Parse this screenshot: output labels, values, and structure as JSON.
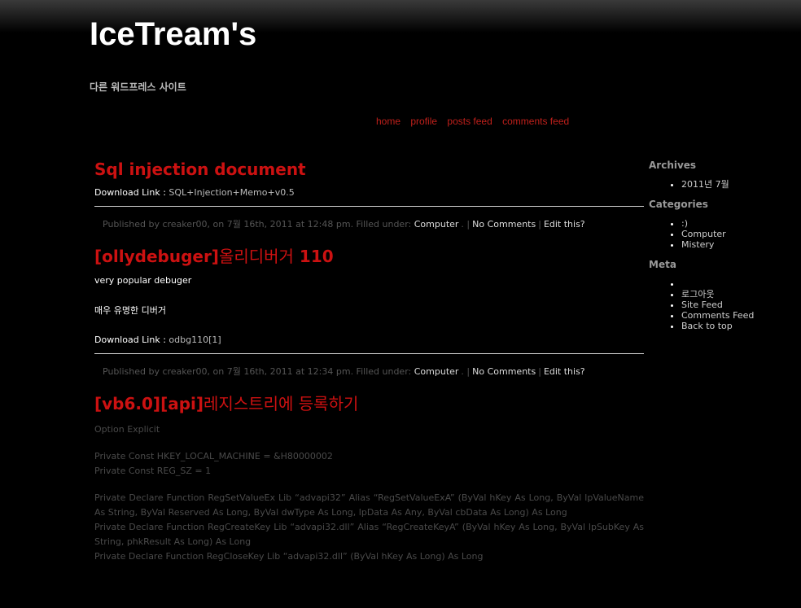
{
  "site": {
    "title": "IceTream's",
    "tagline": "다른 워드프레스 사이트"
  },
  "nav": [
    "home",
    "profile",
    "posts feed",
    "comments feed"
  ],
  "posts": [
    {
      "title": "Sql injection document",
      "download_label": "Download Link :",
      "download_link": "SQL+Injection+Memo+v0.5",
      "meta": {
        "published": "Published by creaker00, on 7월 16th, 2011 at 12:48 pm. Filled under:",
        "category": "Computer",
        "comments": "No Comments",
        "edit": "Edit this?"
      }
    },
    {
      "title_bold": "[ollydebuger]",
      "title_normal": "올리디버거",
      "title_bold2": " 110",
      "para1": "very popular debuger",
      "para2": "매우 유명한 디버거",
      "download_label": "Download Link :",
      "download_link": "odbg110[1]",
      "meta": {
        "published": "Published by creaker00, on 7월 16th, 2011 at 12:34 pm. Filled under:",
        "category": "Computer",
        "comments": "No Comments",
        "edit": "Edit this?"
      }
    },
    {
      "title_bold": "[vb6.0][api]",
      "title_normal": "레지스트리에 등록하기",
      "line1": "Option Explicit",
      "line2": "Private Const HKEY_LOCAL_MACHINE = &H80000002",
      "line3": "Private Const REG_SZ = 1",
      "line4": "Private Declare Function RegSetValueEx Lib “advapi32” Alias “RegSetValueExA” (ByVal hKey As Long, ByVal lpValueName As String, ByVal Reserved As Long, ByVal dwType As Long, lpData As Any, ByVal cbData As Long) As Long",
      "line5": "Private Declare Function RegCreateKey Lib “advapi32.dll” Alias “RegCreateKeyA” (ByVal hKey As Long, ByVal lpSubKey As String, phkResult As Long) As Long",
      "line6": "Private Declare Function RegCloseKey Lib “advapi32.dll” (ByVal hKey As Long) As Long"
    }
  ],
  "sidebar": {
    "archives_title": "Archives",
    "archives": [
      "2011년 7월"
    ],
    "categories_title": "Categories",
    "categories": [
      ":)",
      "Computer",
      "Mistery"
    ],
    "meta_title": "Meta",
    "meta": [
      "",
      "로그아웃",
      "Site Feed",
      "Comments Feed",
      "Back to top"
    ]
  },
  "colors": {
    "background": "#000000",
    "post_title": "#cc1111",
    "nav_link": "#c0201b"
  }
}
